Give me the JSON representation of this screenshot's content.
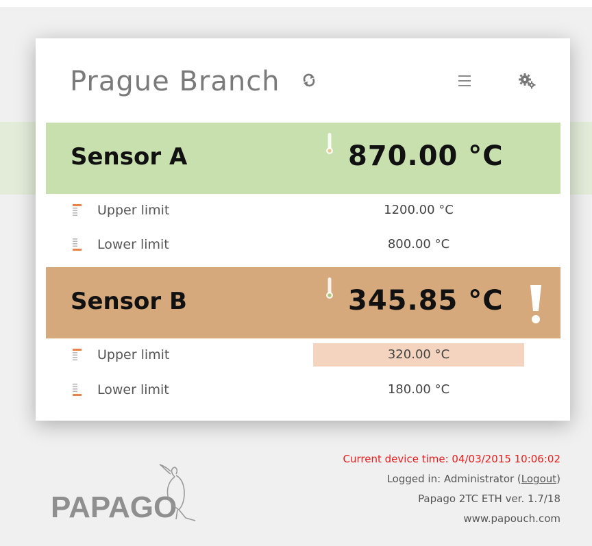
{
  "header": {
    "title": "Prague Branch",
    "icons": [
      "refresh-icon",
      "menu-icon",
      "settings-gear-icon"
    ]
  },
  "sensors": [
    {
      "name": "Sensor A",
      "value": "870.00 °C",
      "status_color": "#c8e0ae",
      "alarm": false,
      "upper_limit": {
        "label": "Upper limit",
        "value": "1200.00 °C",
        "exceeded": false
      },
      "lower_limit": {
        "label": "Lower limit",
        "value": "800.00 °C",
        "exceeded": false
      }
    },
    {
      "name": "Sensor B",
      "value": "345.85 °C",
      "status_color": "#d5a97c",
      "alarm": true,
      "upper_limit": {
        "label": "Upper limit",
        "value": "320.00 °C",
        "exceeded": true
      },
      "lower_limit": {
        "label": "Lower limit",
        "value": "180.00 °C",
        "exceeded": false
      }
    }
  ],
  "footer": {
    "device_time": "Current device time: 04/03/2015 10:06:02",
    "logged_in_prefix": "Logged in: Administrator (",
    "logout_label": "Logout",
    "logged_in_suffix": ")",
    "version": "Papago 2TC ETH ver. 1.7/18",
    "website": "www.papouch.com"
  },
  "logo": {
    "text": "PAPAGO"
  },
  "colors": {
    "ok": "#c8e0ae",
    "alarm": "#d5a97c",
    "limit_exceeded": "#f5d4bf",
    "time_text": "#e81c1c",
    "limit_icon_accent": "#e8834a"
  }
}
